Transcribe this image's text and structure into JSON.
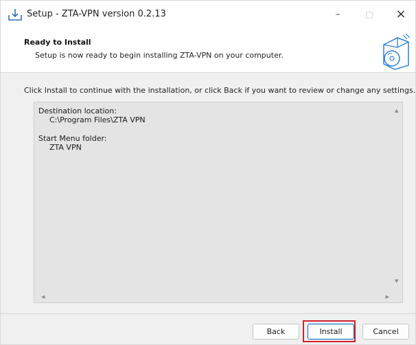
{
  "window": {
    "title": "Setup - ZTA-VPN version 0.2.13",
    "controls": {
      "minimize": "–",
      "maximize": "□",
      "close": "×"
    }
  },
  "header": {
    "title": "Ready to Install",
    "subtitle": "Setup is now ready to begin installing ZTA-VPN on your computer."
  },
  "instruction": "Click Install to continue with the installation, or click Back if you want to review or change any settings.",
  "memo": {
    "lines": [
      "Destination location:",
      "C:\\Program Files\\ZTA VPN",
      "Start Menu folder:",
      "ZTA VPN"
    ]
  },
  "buttons": {
    "back": "Back",
    "install": "Install",
    "cancel": "Cancel"
  },
  "colors": {
    "highlight": "#d2202f",
    "accent": "#0067c0"
  }
}
